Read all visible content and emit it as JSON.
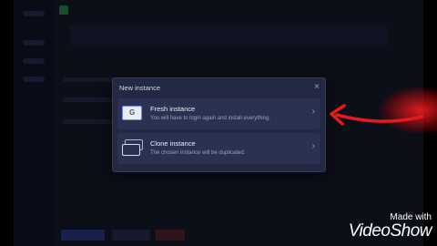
{
  "modal": {
    "title": "New instance",
    "close_glyph": "×",
    "options": [
      {
        "title": "Fresh instance",
        "description": "You will have to login again and install everything.",
        "icon": "fresh-instance-icon",
        "chevron": "›"
      },
      {
        "title": "Clone instance",
        "description": "The chosen instance will be duplicated.",
        "icon": "clone-instance-icon",
        "chevron": "›"
      }
    ]
  },
  "annotation": {
    "color": "#e31b1b"
  },
  "watermark": {
    "line1": "Made with",
    "line2": "VideoShow"
  }
}
